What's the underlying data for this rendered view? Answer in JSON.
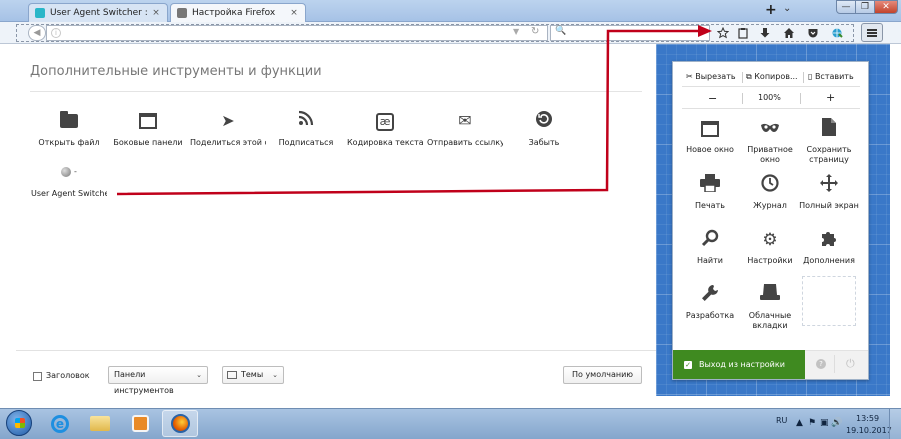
{
  "tabs": [
    {
      "label": "User Agent Switcher :: Add-o",
      "close": "×"
    },
    {
      "label": "Настройка Firefox",
      "close": "×"
    }
  ],
  "tabbar": {
    "new_tab": "+",
    "all_tabs": "⌄"
  },
  "window_controls": {
    "minimize": "—",
    "maximize": "❐",
    "close": "✕"
  },
  "navbar": {
    "back_icon": "◀",
    "info_icon": "i",
    "dropdown_icon": "▼",
    "reload_icon": "↻",
    "search_icon": "🔍",
    "icons": [
      "star-icon",
      "clipboard-icon",
      "download-icon",
      "home-icon",
      "pocket-icon",
      "ua-switcher-icon"
    ]
  },
  "customize": {
    "title": "Дополнительные инструменты и функции",
    "palette": [
      {
        "label": "Открыть файл",
        "icon": "folder-icon"
      },
      {
        "label": "Боковые панели",
        "icon": "sidebar-icon"
      },
      {
        "label": "Поделиться этой ст...",
        "icon": "share-icon",
        "glyph": "➤"
      },
      {
        "label": "Подписаться",
        "icon": "rss-icon",
        "glyph": "❩"
      },
      {
        "label": "Кодировка текста",
        "icon": "encoding-icon",
        "glyph": "æ"
      },
      {
        "label": "Отправить ссылку",
        "icon": "mail-icon",
        "glyph": "✉"
      },
      {
        "label": "Забыть",
        "icon": "forget-icon",
        "glyph": "⟲"
      }
    ],
    "ua_item": {
      "label": "User Agent Switcher",
      "dash": "-"
    },
    "footer": {
      "titlebar_label": "Заголовок",
      "toolbars_label": "Панели инструментов",
      "themes_label": "Темы",
      "restore_label": "По умолчанию",
      "arrow": "⌄"
    }
  },
  "menu_panel": {
    "edit": {
      "cut": "✂ Вырезать",
      "copy": "⧉ Копиров...",
      "paste": "▯ Вставить"
    },
    "zoom": {
      "minus": "−",
      "level": "100%",
      "plus": "+"
    },
    "items": [
      {
        "label": "Новое окно",
        "icon": "new-window-icon",
        "glyph": "▭"
      },
      {
        "label": "Приватное окно",
        "icon": "private-mask-icon",
        "glyph": "◠◠"
      },
      {
        "label": "Сохранить страницу",
        "icon": "save-page-icon",
        "glyph": "▮"
      },
      {
        "label": "Печать",
        "icon": "print-icon",
        "glyph": "⎙"
      },
      {
        "label": "Журнал",
        "icon": "history-clock-icon",
        "glyph": "◷"
      },
      {
        "label": "Полный экран",
        "icon": "fullscreen-icon",
        "glyph": "✥"
      },
      {
        "label": "Найти",
        "icon": "find-icon",
        "glyph": "⚲"
      },
      {
        "label": "Настройки",
        "icon": "settings-gear-icon",
        "glyph": "⚙"
      },
      {
        "label": "Дополнения",
        "icon": "addons-puzzle-icon",
        "glyph": "✚"
      },
      {
        "label": "Разработка",
        "icon": "developer-wrench-icon",
        "glyph": "🔧"
      },
      {
        "label": "Облачные вкладки",
        "icon": "synced-tabs-icon",
        "glyph": "▬"
      }
    ],
    "exit_label": "Выход из настройки",
    "exit_check": "✓",
    "help_glyph": "?",
    "quit_glyph": "⏻"
  },
  "taskbar": {
    "ie_glyph": "e",
    "language": "RU",
    "tray_icons": [
      "▲",
      "⚑",
      "▣",
      "🔊"
    ],
    "time": "13:59",
    "date": "19.10.2017"
  },
  "colors": {
    "blueprint": "#3a78c8",
    "exit_green": "#3f8a20",
    "annotation_red": "#c0001a"
  }
}
